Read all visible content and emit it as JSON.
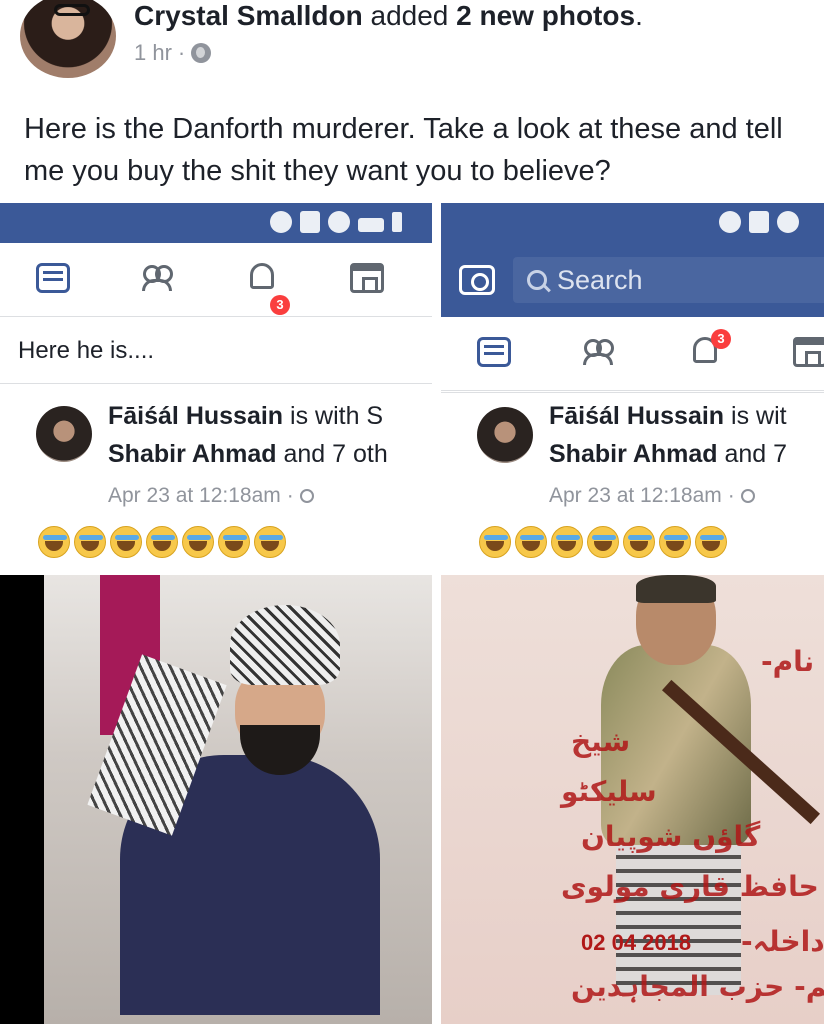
{
  "post": {
    "author": "Crystal Smalldon",
    "action": " added ",
    "photo_count": "2 new photos",
    "period": ".",
    "time": "1 hr",
    "separator": "·",
    "text": "Here is the Danforth murderer. Take a look at these and tell me you buy the shit they want you to believe?"
  },
  "left_screenshot": {
    "status_icons": [
      "bluetooth-icon",
      "nfc-icon",
      "wifi-icon",
      "signal-icon",
      "battery-icon"
    ],
    "nav_icons": [
      "news-feed-icon",
      "friends-icon",
      "notifications-icon",
      "marketplace-icon"
    ],
    "notification_badge": "3",
    "caption": "Here he is....",
    "card": {
      "name": "Fāiśál Hussain",
      "with_text": " is with S",
      "line2_name": "Shabir Ahmad",
      "line2_rest": " and 7 oth",
      "time": "Apr 23 at 12:18am",
      "dot": "·"
    },
    "emoji_count_label": "7 crying faces"
  },
  "right_screenshot": {
    "search_placeholder": "Search",
    "notification_badge": "3",
    "card": {
      "name": "Fāiśál Hussain",
      "with_text": " is wit",
      "line2_name": "Shabir Ahmad",
      "line2_rest": " and 7",
      "time": "Apr 23 at 12:18am",
      "dot": "·"
    },
    "photo_text": {
      "name_label": "نام-",
      "line1": "شیخ",
      "line2": "سلیکٹو",
      "line3": "گاؤں شوپیان",
      "line4": "یم- حافظ قاری مولوی",
      "line5": "داخلہ-",
      "line6": "تنظیم- حزب المجاہدین",
      "date": "02 04 2018"
    }
  },
  "colors": {
    "facebook_blue": "#3b5998",
    "badge_red": "#fa3e3e",
    "meta_gray": "#90949c"
  }
}
